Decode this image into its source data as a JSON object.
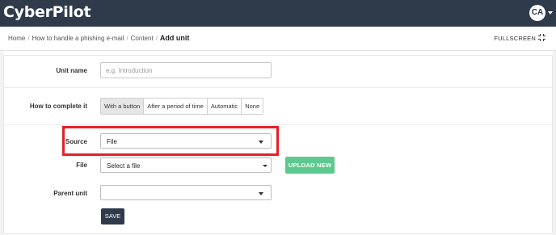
{
  "app": {
    "logo": "CyberPilot",
    "avatar_initials": "CA"
  },
  "breadcrumb": {
    "items": [
      "Home",
      "How to handle a phishing e-mail",
      "Content"
    ],
    "current": "Add unit"
  },
  "header": {
    "fullscreen_label": "FULLSCREEN",
    "fullscreen_icon": "expand-icon"
  },
  "form": {
    "unit_name": {
      "label": "Unit name",
      "value": "",
      "placeholder": "e.g. Introduction"
    },
    "completion": {
      "label": "How to complete it",
      "options": [
        "With a button",
        "After a period of time",
        "Automatic",
        "None"
      ],
      "selected": "With a button"
    },
    "source": {
      "label": "Source",
      "value": "File"
    },
    "file": {
      "label": "File",
      "value": "Select a file",
      "upload_label": "UPLOAD NEW"
    },
    "parent_unit": {
      "label": "Parent unit",
      "value": ""
    },
    "save_label": "SAVE"
  },
  "colors": {
    "topbar": "#2f3a4b",
    "upload_button": "#5ec98e",
    "highlight": "#e5202a"
  }
}
